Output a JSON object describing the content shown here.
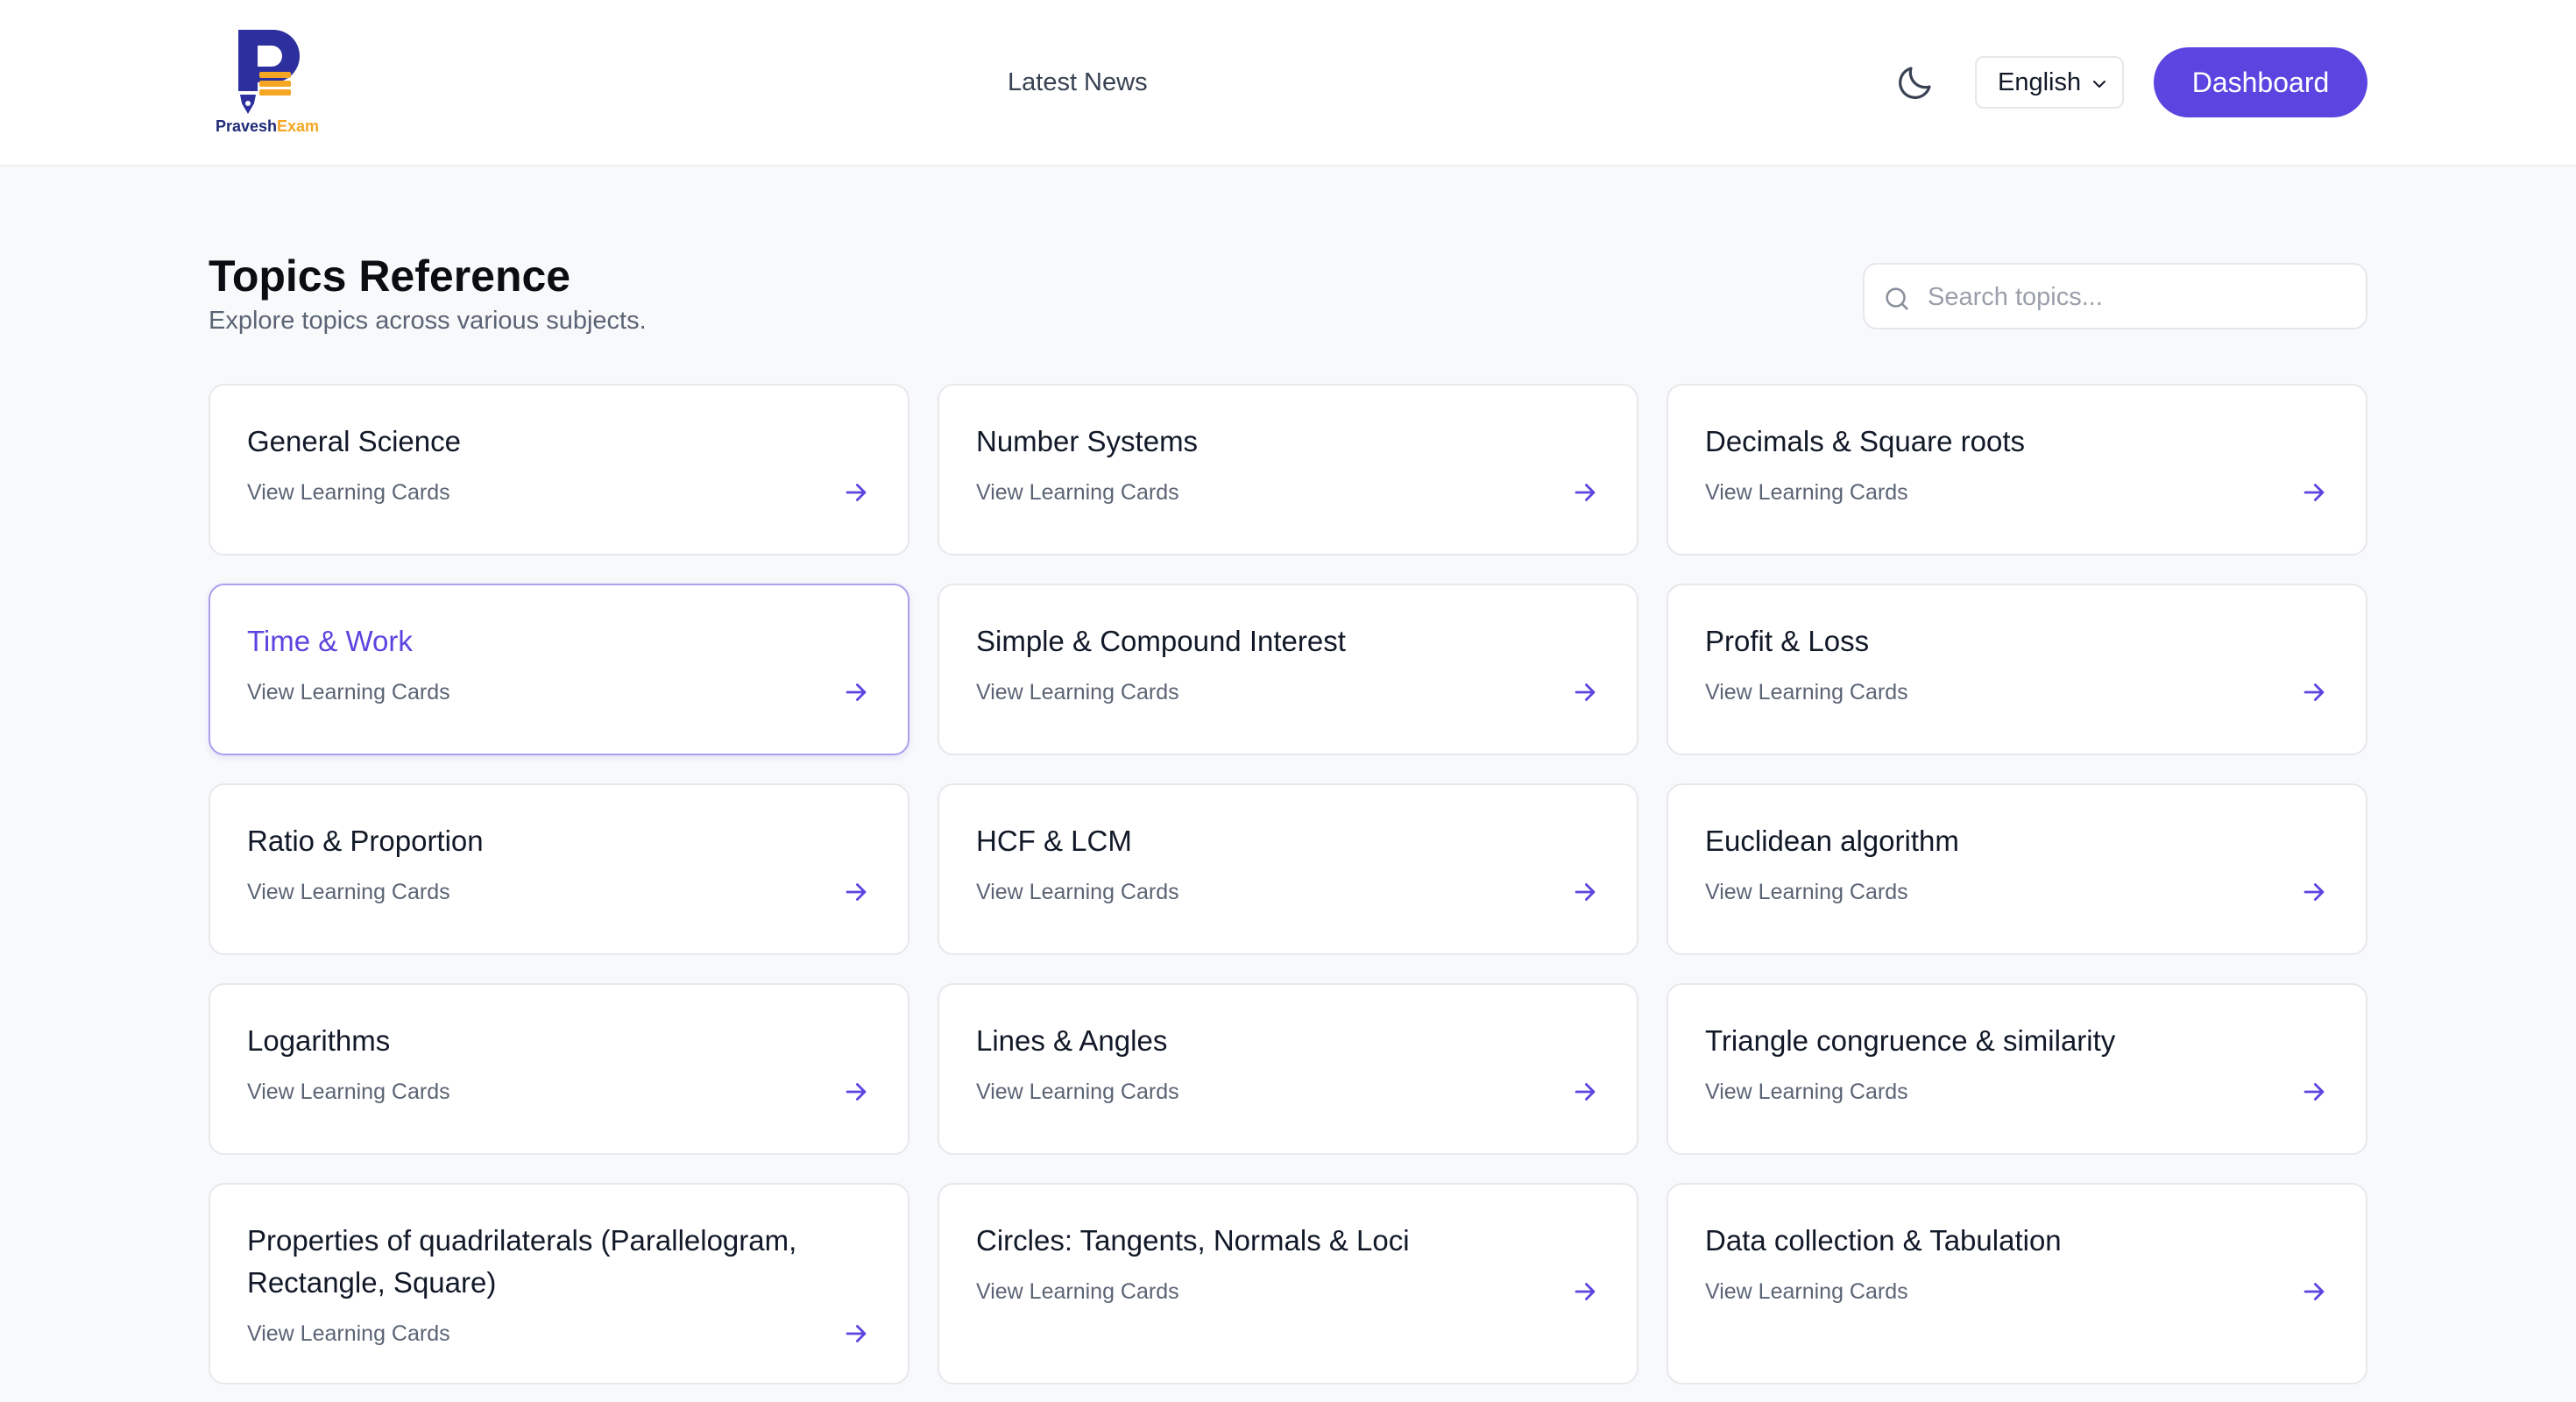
{
  "header": {
    "logo": {
      "part1": "Pravesh",
      "part2": "Exam"
    },
    "nav_link": "Latest News",
    "language": "English",
    "dashboard_label": "Dashboard"
  },
  "page": {
    "title": "Topics Reference",
    "subtitle": "Explore topics across various subjects."
  },
  "search": {
    "placeholder": "Search topics..."
  },
  "card_link_label": "View Learning Cards",
  "topics": [
    {
      "title": "General Science",
      "link": "View Learning Cards"
    },
    {
      "title": "Number Systems",
      "link": "View Learning Cards"
    },
    {
      "title": "Decimals & Square roots",
      "link": "View Learning Cards"
    },
    {
      "title": "Time & Work",
      "link": "View Learning Cards",
      "active": true
    },
    {
      "title": "Simple & Compound Interest",
      "link": "View Learning Cards"
    },
    {
      "title": "Profit & Loss",
      "link": "View Learning Cards"
    },
    {
      "title": "Ratio & Proportion",
      "link": "View Learning Cards"
    },
    {
      "title": "HCF & LCM",
      "link": "View Learning Cards"
    },
    {
      "title": "Euclidean algorithm",
      "link": "View Learning Cards"
    },
    {
      "title": "Logarithms",
      "link": "View Learning Cards"
    },
    {
      "title": "Lines & Angles",
      "link": "View Learning Cards"
    },
    {
      "title": "Triangle congruence & similarity",
      "link": "View Learning Cards"
    },
    {
      "title": "Properties of quadrilaterals (Parallelogram, Rectangle, Square)",
      "link": "View Learning Cards"
    },
    {
      "title": "Circles: Tangents, Normals & Loci",
      "link": "View Learning Cards"
    },
    {
      "title": "Data collection & Tabulation",
      "link": "View Learning Cards"
    }
  ],
  "colors": {
    "accent": "#5b45e0",
    "logo_navy": "#1e2a78",
    "logo_orange": "#f5a623"
  },
  "icons": {
    "theme_toggle": "moon-icon",
    "language_dropdown": "chevron-down-icon",
    "search": "search-icon",
    "card_action": "arrow-right-icon"
  }
}
